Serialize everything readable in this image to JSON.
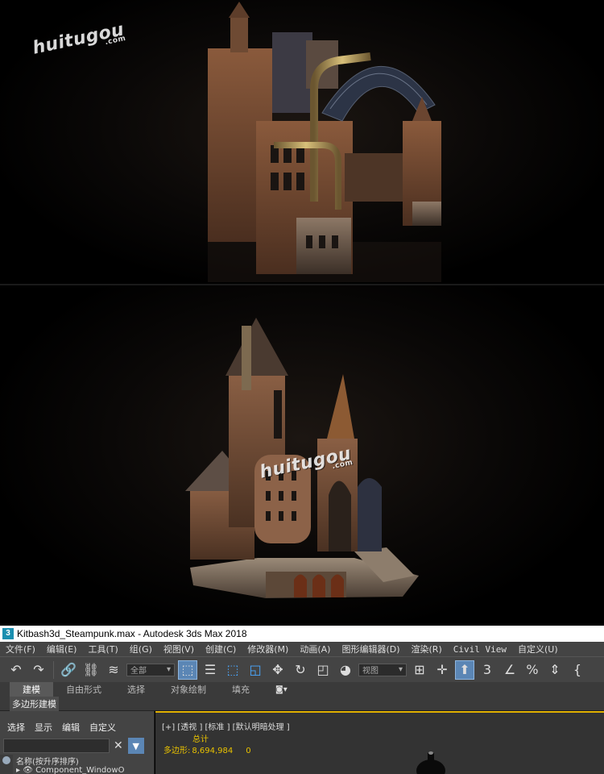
{
  "watermark": {
    "text": "huitugou",
    "suffix": ".com"
  },
  "window": {
    "title": "Kitbash3d_Steampunk.max - Autodesk 3ds Max 2018",
    "icon_label": "3"
  },
  "menu": [
    "文件(F)",
    "编辑(E)",
    "工具(T)",
    "组(G)",
    "视图(V)",
    "创建(C)",
    "修改器(M)",
    "动画(A)",
    "图形编辑器(D)",
    "渲染(R)",
    "Civil View",
    "自定义(U)"
  ],
  "toolbar": {
    "selection_filter": "全部",
    "reference_coord": "视图"
  },
  "ribbon": {
    "tabs": [
      "建模",
      "自由形式",
      "选择",
      "对象绘制",
      "填充"
    ],
    "active_tab": "建模",
    "sub_label": "多边形建模"
  },
  "scene_explorer": {
    "menu": [
      "选择",
      "显示",
      "编辑",
      "自定义"
    ],
    "column_header": "名称(按升序排序)",
    "first_row": "Component_WindowO"
  },
  "viewport": {
    "label": "[+] [透视 ] [标准 ] [默认明暗处理 ]",
    "stats_header": "总计",
    "polys_label": "多边形:",
    "polys_total": "8,694,984",
    "polys_selected": "0"
  },
  "colors": {
    "accent_blue": "#5b86b5",
    "stats_yellow": "#e8c100",
    "viewport_border": "#e0b000",
    "ui_gray": "#444444"
  }
}
